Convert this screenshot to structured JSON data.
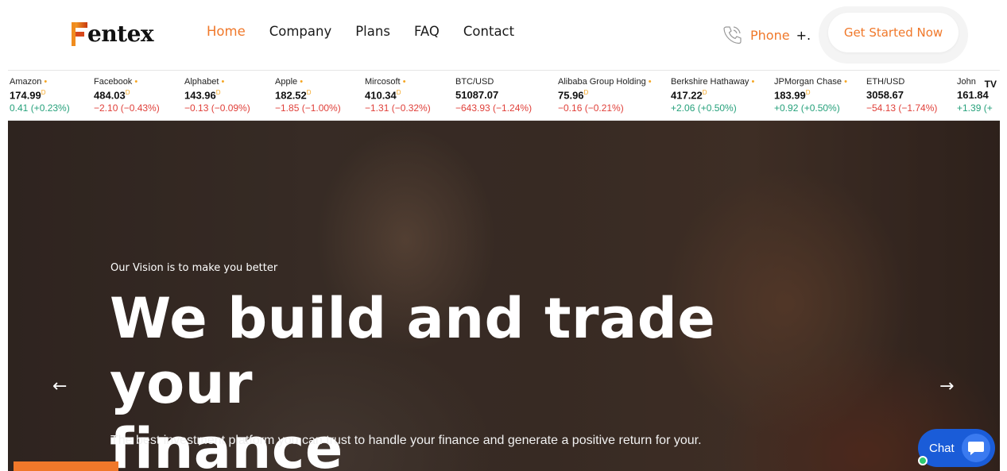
{
  "header": {
    "logo_text": "entex",
    "nav": [
      {
        "label": "Home",
        "active": true
      },
      {
        "label": "Company",
        "active": false
      },
      {
        "label": "Plans",
        "active": false
      },
      {
        "label": "FAQ",
        "active": false
      },
      {
        "label": "Contact",
        "active": false
      }
    ],
    "phone_label": "Phone",
    "phone_value": "+.",
    "cta_label": "Get Started Now",
    "accent_color": "#f0782a"
  },
  "ticker": {
    "items": [
      {
        "name": "Amazon",
        "price": "174.99",
        "change": "0.41 (+0.23%)",
        "direction": "up"
      },
      {
        "name": "Facebook",
        "price": "484.03",
        "change": "−2.10 (−0.43%)",
        "direction": "down"
      },
      {
        "name": "Alphabet",
        "price": "143.96",
        "change": "−0.13 (−0.09%)",
        "direction": "down"
      },
      {
        "name": "Apple",
        "price": "182.52",
        "change": "−1.85 (−1.00%)",
        "direction": "down"
      },
      {
        "name": "Mircosoft",
        "price": "410.34",
        "change": "−1.31 (−0.32%)",
        "direction": "down"
      },
      {
        "name": "BTC/USD",
        "price": "51087.07",
        "change": "−643.93 (−1.24%)",
        "direction": "down"
      },
      {
        "name": "Alibaba Group Holding",
        "price": "75.96",
        "change": "−0.16 (−0.21%)",
        "direction": "down"
      },
      {
        "name": "Berkshire Hathaway",
        "price": "417.22",
        "change": "+2.06 (+0.50%)",
        "direction": "up"
      },
      {
        "name": "JPMorgan Chase",
        "price": "183.99",
        "change": "+0.92 (+0.50%)",
        "direction": "up"
      },
      {
        "name": "ETH/USD",
        "price": "3058.67",
        "change": "−54.13 (−1.74%)",
        "direction": "down"
      },
      {
        "name": "John",
        "price": "161.84",
        "change": "+1.39 (+",
        "direction": "up"
      }
    ],
    "badge": "D",
    "provider_logo": "TV"
  },
  "hero": {
    "subtitle": "Our Vision is to make you better",
    "title_line1": "We build and trade your",
    "title_line2": "finance",
    "description": "The best investment platform you can trust to handle your finance and generate a positive return for your.",
    "prev_arrow": "←",
    "next_arrow": "→"
  },
  "chat": {
    "label": "Chat",
    "color": "#1a5cd8"
  }
}
